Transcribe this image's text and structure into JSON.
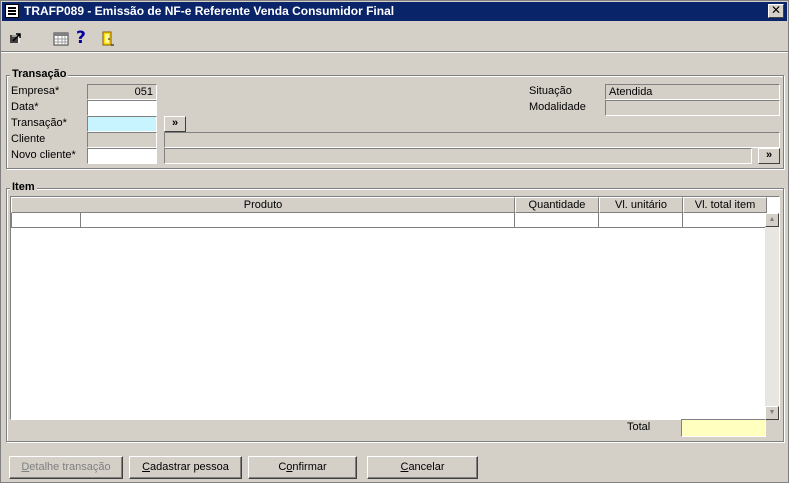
{
  "window": {
    "title": "TRAFP089 - Emissão de NF-e Referente Venda Consumidor Final",
    "close_glyph": "✕"
  },
  "toolbar": {
    "icons": [
      "exit-arrow-icon",
      "calendar-icon",
      "help-icon",
      "door-exit-icon"
    ],
    "help_glyph": "?"
  },
  "transacao": {
    "legend": "Transação",
    "empresa_label": "Empresa*",
    "empresa_value": "051",
    "data_label": "Data*",
    "data_value": "",
    "transacao_label": "Transação*",
    "transacao_value": "",
    "cliente_label": "Cliente",
    "cliente_value": "",
    "cliente_name": "",
    "novo_cliente_label": "Novo cliente*",
    "novo_cliente_value": "",
    "novo_cliente_name": "",
    "situacao_label": "Situação",
    "situacao_value": "Atendida",
    "modalidade_label": "Modalidade",
    "modalidade_value": "",
    "lookup_glyph": "»"
  },
  "item": {
    "legend": "Item",
    "columns": [
      "Produto",
      "Quantidade",
      "Vl. unitário",
      "Vl. total item"
    ],
    "total_label": "Total",
    "total_value": "",
    "scroll_up": "▲",
    "scroll_down": "▼"
  },
  "buttons": {
    "detalhe_first": "D",
    "detalhe_rest": "etalhe transação",
    "cadastrar_first": "C",
    "cadastrar_rest": "adastrar pessoa",
    "confirmar_pre": "C",
    "confirmar_ul": "o",
    "confirmar_rest": "nfirmar",
    "cancelar_first": "C",
    "cancelar_rest": "ancelar"
  },
  "colors": {
    "titlebar": "#0a246a",
    "face": "#d4d0c8",
    "transacao_field": "#c8f4ff",
    "total_field": "#ffffc0"
  }
}
